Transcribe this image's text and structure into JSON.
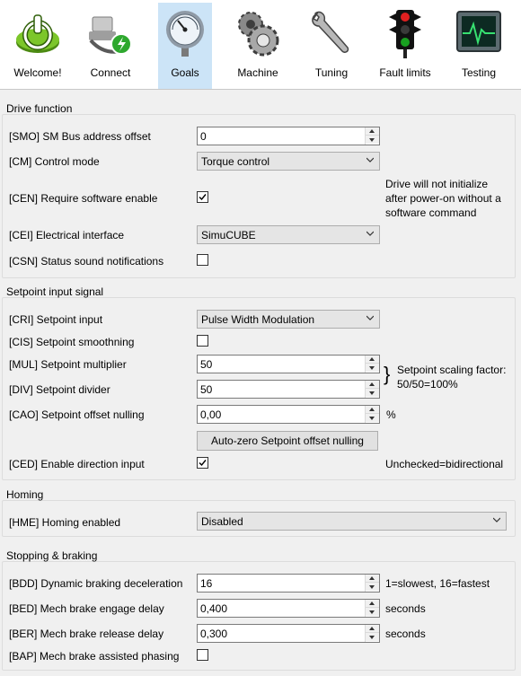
{
  "toolbar": {
    "items": [
      {
        "label": "Welcome!",
        "icon": "power-icon"
      },
      {
        "label": "Connect",
        "icon": "network-cable-icon"
      },
      {
        "label": "Goals",
        "icon": "gauge-icon"
      },
      {
        "label": "Machine",
        "icon": "gears-icon"
      },
      {
        "label": "Tuning",
        "icon": "wrench-icon"
      },
      {
        "label": "Fault limits",
        "icon": "traffic-light-icon"
      },
      {
        "label": "Testing",
        "icon": "monitor-icon"
      }
    ],
    "active": "Goals"
  },
  "drive_function": {
    "title": "Drive function",
    "smo": {
      "label": "[SMO] SM Bus address offset",
      "value": "0"
    },
    "cm": {
      "label": "[CM] Control mode",
      "value": "Torque control"
    },
    "cen": {
      "label": "[CEN] Require software enable",
      "checked": true,
      "note": [
        "Drive will not initialize",
        "after power-on without a",
        "software command"
      ]
    },
    "cei": {
      "label": "[CEI] Electrical interface",
      "value": "SimuCUBE"
    },
    "csn": {
      "label": "[CSN] Status sound notifications",
      "checked": false
    }
  },
  "setpoint": {
    "title": "Setpoint input signal",
    "cri": {
      "label": "[CRI] Setpoint input",
      "value": "Pulse Width Modulation"
    },
    "cis": {
      "label": "[CIS] Setpoint smoothning",
      "checked": false
    },
    "mul": {
      "label": "[MUL] Setpoint multiplier",
      "value": "50"
    },
    "div": {
      "label": "[DIV] Setpoint divider",
      "value": "50"
    },
    "scaling_note": [
      "Setpoint scaling factor:",
      "50/50=100%"
    ],
    "cao": {
      "label": "[CAO] Setpoint offset nulling",
      "value": "0,00",
      "unit": "%"
    },
    "autozero_label": "Auto-zero Setpoint offset nulling",
    "ced": {
      "label": "[CED] Enable direction input",
      "checked": true,
      "note": "Unchecked=bidirectional"
    }
  },
  "homing": {
    "title": "Homing",
    "hme": {
      "label": "[HME] Homing enabled",
      "value": "Disabled"
    }
  },
  "stopping": {
    "title": "Stopping & braking",
    "bdd": {
      "label": "[BDD] Dynamic braking deceleration",
      "value": "16",
      "note": "1=slowest, 16=fastest"
    },
    "bed": {
      "label": "[BED] Mech brake engage delay",
      "value": "0,400",
      "unit": "seconds"
    },
    "ber": {
      "label": "[BER] Mech brake release delay",
      "value": "0,300",
      "unit": "seconds"
    },
    "bap": {
      "label": "[BAP] Mech brake assisted phasing",
      "checked": false
    }
  },
  "colors": {
    "active_tab": "#cce4f7",
    "window_bg": "#f0f0f0"
  }
}
